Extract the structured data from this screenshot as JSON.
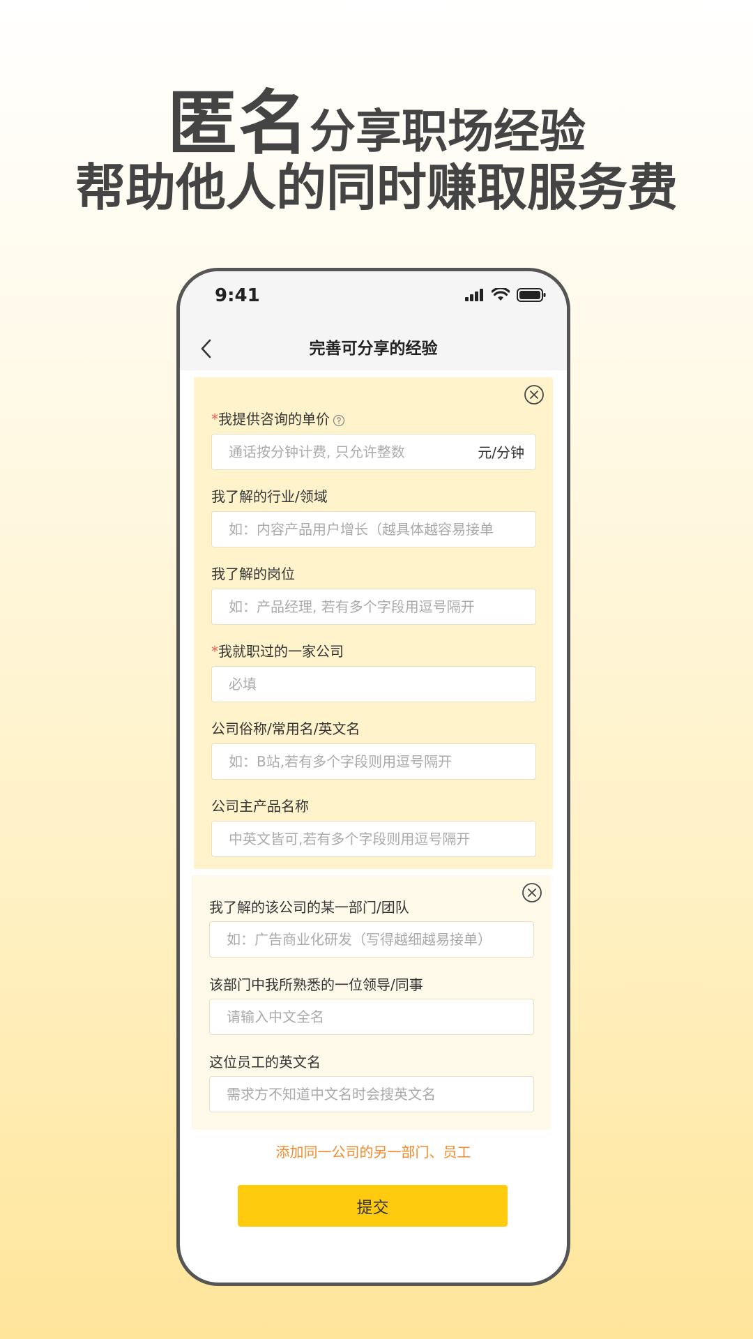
{
  "headline": {
    "emphasis": "匿名",
    "rest": "分享职场经验",
    "subline": "帮助他人的同时赚取服务费"
  },
  "phone": {
    "status_time": "9:41",
    "nav_title": "完善可分享的经验",
    "card1": {
      "fields": [
        {
          "label": "我提供咨询的单价",
          "required": true,
          "placeholder": "通话按分钟计费, 只允许整数",
          "unit": "元/分钟"
        },
        {
          "label": "我了解的行业/领域",
          "required": false,
          "placeholder": "如：内容产品用户增长（越具体越容易接单"
        },
        {
          "label": "我了解的岗位",
          "required": false,
          "placeholder": "如：产品经理, 若有多个字段用逗号隔开"
        },
        {
          "label": "我就职过的一家公司",
          "required": true,
          "placeholder": "必填"
        },
        {
          "label": "公司俗称/常用名/英文名",
          "required": false,
          "placeholder": "如：B站,若有多个字段则用逗号隔开"
        },
        {
          "label": "公司主产品名称",
          "required": false,
          "placeholder": "中英文皆可,若有多个字段则用逗号隔开"
        }
      ]
    },
    "card2": {
      "fields": [
        {
          "label": "我了解的该公司的某一部门/团队",
          "placeholder": "如：广告商业化研发（写得越细越易接单）"
        },
        {
          "label": "该部门中我所熟悉的一位领导/同事",
          "placeholder": "请输入中文全名"
        },
        {
          "label": "这位员工的英文名",
          "placeholder": "需求方不知道中文名时会搜英文名"
        }
      ]
    },
    "required_mark": "*",
    "add_link": "添加同一公司的另一部门、员工",
    "submit_label": "提交"
  },
  "colors": {
    "accent": "#ffcb0f",
    "link": "#f08a2b",
    "required": "#f05a5a",
    "card1_bg": "#fff3cc",
    "card2_bg": "#fff9ea"
  }
}
